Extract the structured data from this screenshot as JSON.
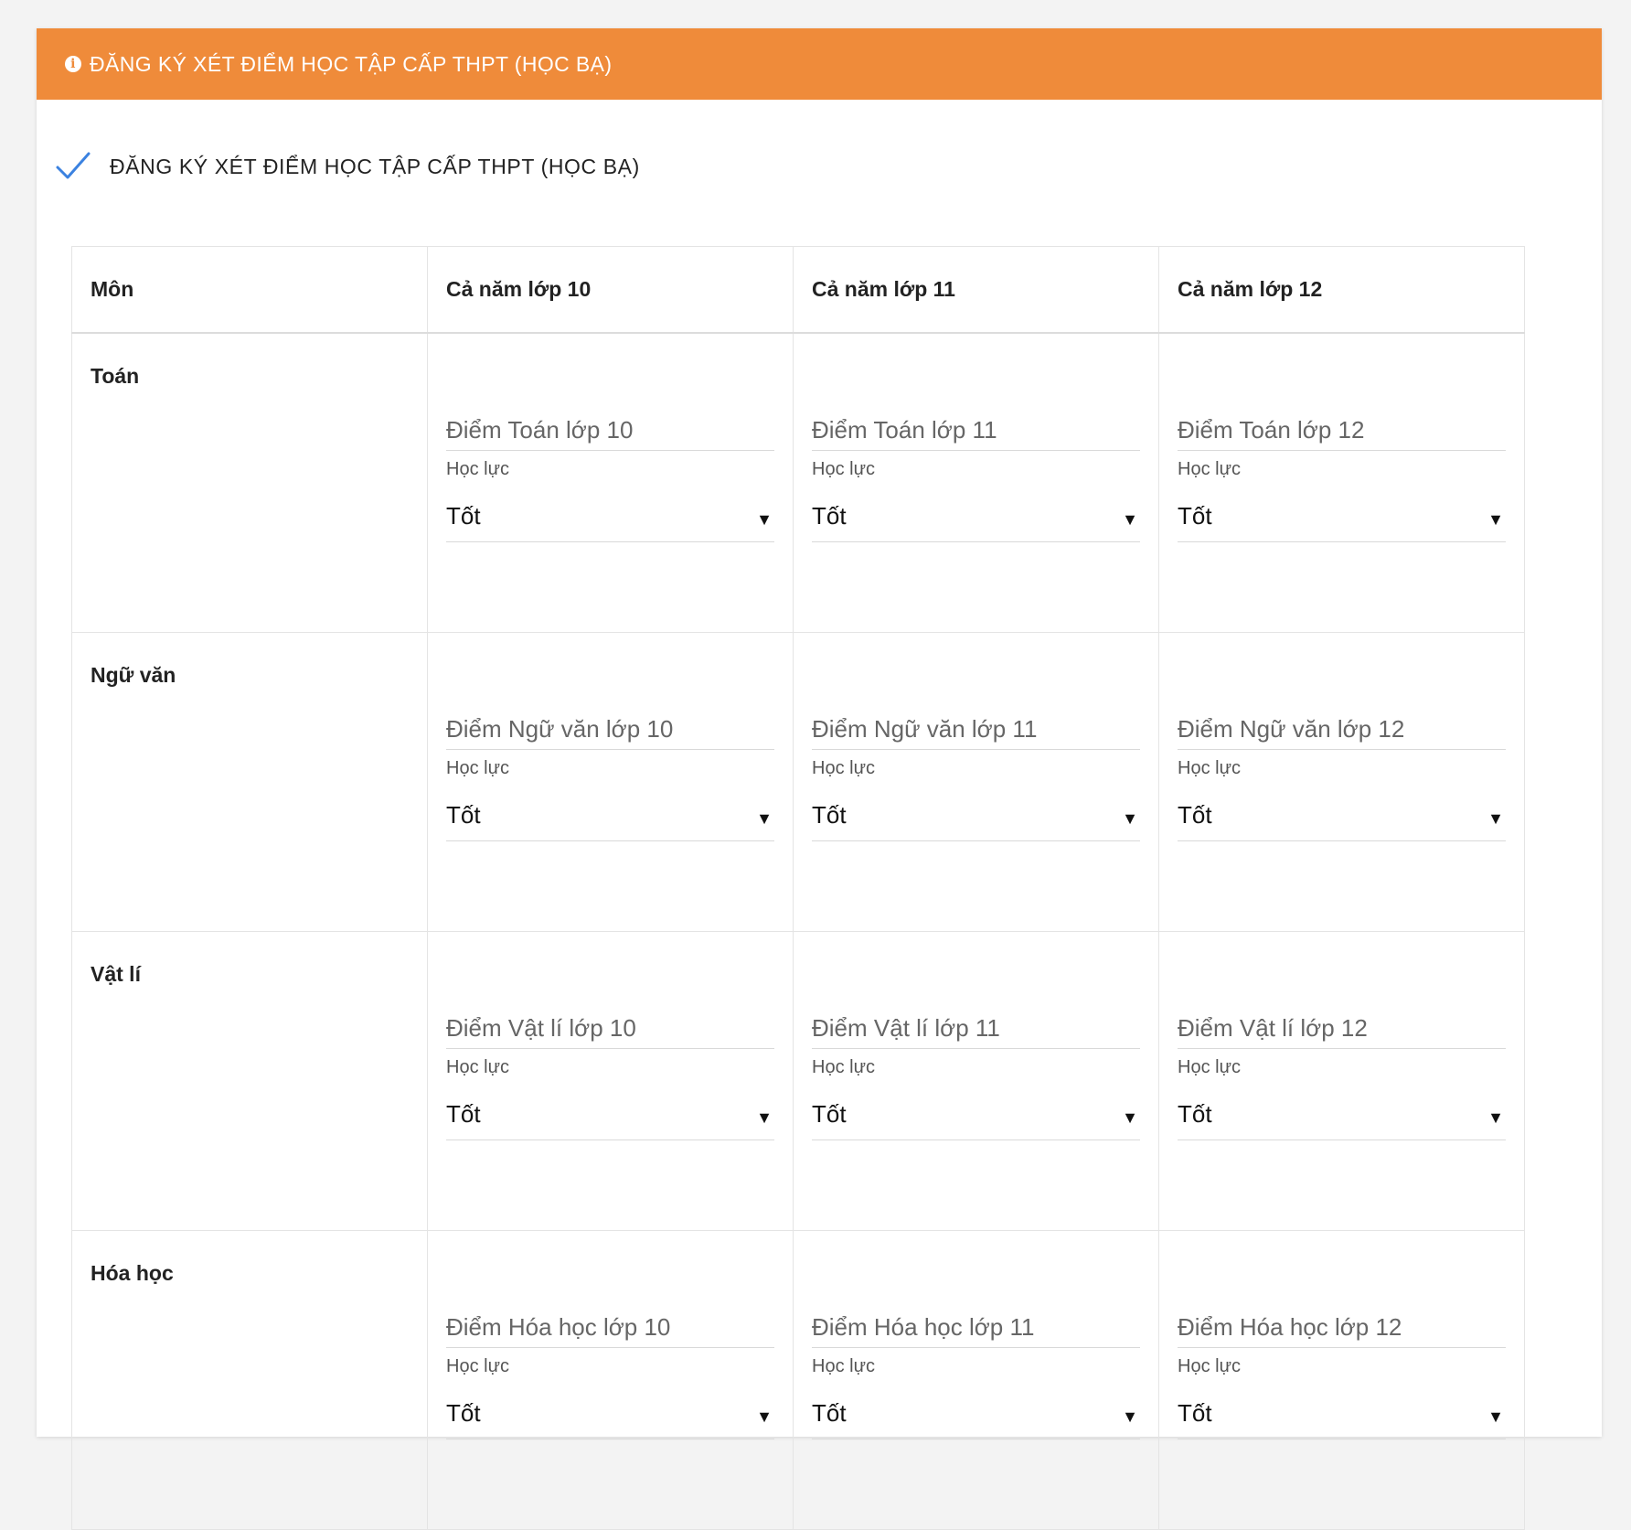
{
  "header": {
    "title": "ĐĂNG KÝ XÉT ĐIỂM HỌC TẬP CẤP THPT (HỌC BẠ)"
  },
  "option": {
    "label": "ĐĂNG KÝ XÉT ĐIỂM HỌC TẬP CẤP THPT (HỌC BẠ)",
    "checked": true,
    "check_color": "#3b82e0"
  },
  "colors": {
    "header_bg": "#ef8b3a",
    "header_text": "#ffffff"
  },
  "table": {
    "columns": [
      "Môn",
      "Cả năm lớp 10",
      "Cả năm lớp 11",
      "Cả năm lớp 12"
    ],
    "rank_label": "Học lực",
    "rows": [
      {
        "subject": "Toán",
        "fields": [
          {
            "placeholder": "Điểm Toán lớp 10",
            "rank": "Tốt"
          },
          {
            "placeholder": "Điểm Toán lớp 11",
            "rank": "Tốt"
          },
          {
            "placeholder": "Điểm Toán lớp 12",
            "rank": "Tốt"
          }
        ]
      },
      {
        "subject": "Ngữ văn",
        "fields": [
          {
            "placeholder": "Điểm Ngữ văn lớp 10",
            "rank": "Tốt"
          },
          {
            "placeholder": "Điểm Ngữ văn lớp 11",
            "rank": "Tốt"
          },
          {
            "placeholder": "Điểm Ngữ văn lớp 12",
            "rank": "Tốt"
          }
        ]
      },
      {
        "subject": "Vật lí",
        "fields": [
          {
            "placeholder": "Điểm Vật lí lớp 10",
            "rank": "Tốt"
          },
          {
            "placeholder": "Điểm Vật lí lớp 11",
            "rank": "Tốt"
          },
          {
            "placeholder": "Điểm Vật lí lớp 12",
            "rank": "Tốt"
          }
        ]
      },
      {
        "subject": "Hóa học",
        "fields": [
          {
            "placeholder": "Điểm Hóa học lớp 10",
            "rank": "Tốt"
          },
          {
            "placeholder": "Điểm Hóa học lớp 11",
            "rank": "Tốt"
          },
          {
            "placeholder": "Điểm Hóa học lớp 12",
            "rank": "Tốt"
          }
        ]
      }
    ]
  }
}
